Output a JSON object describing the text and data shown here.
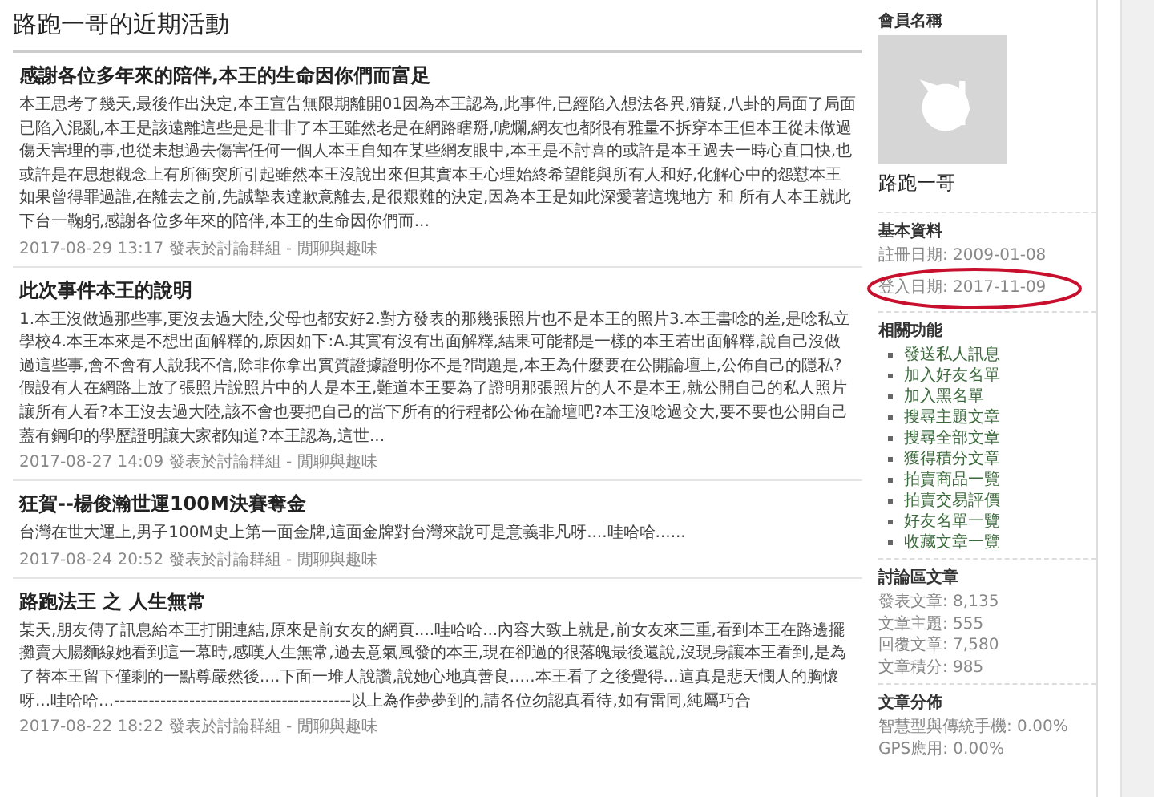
{
  "page_title": "路跑一哥的近期活動",
  "posts": [
    {
      "title": "感謝各位多年來的陪伴,本王的生命因你們而富足",
      "body": "本王思考了幾天,最後作出決定,本王宣告無限期離開01因為本王認為,此事件,已經陷入想法各異,猜疑,八卦的局面了局面已陷入混亂,本王是該遠離這些是是非非了本王雖然老是在網路瞎掰,唬爛,網友也都很有雅量不拆穿本王但本王從未做過傷天害理的事,也從未想過去傷害任何一個人本王自知在某些網友眼中,本王是不討喜的或許是本王過去一時心直口快,也或許是在思想觀念上有所衝突所引起雖然本王沒說出來但其實本王心理始終希望能與所有人和好,化解心中的怨懟本王如果曾得罪過誰,在離去之前,先誠摯表達歉意離去,是很艱難的決定,因為本王是如此深愛著這塊地方 和 所有人本王就此下台一鞠躬,感謝各位多年來的陪伴,本王的生命因你們而...",
      "meta": "2017-08-29 13:17 發表於討論群組 - 閒聊與趣味"
    },
    {
      "title": "此次事件本王的說明",
      "body": "1.本王沒做過那些事,更沒去過大陸,父母也都安好2.對方發表的那幾張照片也不是本王的照片3.本王書唸的差,是唸私立學校4.本王本來是不想出面解釋的,原因如下:A.其實有沒有出面解釋,結果可能都是一樣的本王若出面解釋,說自己沒做過這些事,會不會有人說我不信,除非你拿出實質證據證明你不是?問題是,本王為什麼要在公開論壇上,公佈自己的隱私?假設有人在網路上放了張照片說照片中的人是本王,難道本王要為了證明那張照片的人不是本王,就公開自己的私人照片讓所有人看?本王沒去過大陸,該不會也要把自己的當下所有的行程都公佈在論壇吧?本王沒唸過交大,要不要也公開自己蓋有鋼印的學歷證明讓大家都知道?本王認為,這世...",
      "meta": "2017-08-27 14:09 發表於討論群組 - 閒聊與趣味"
    },
    {
      "title": "狂賀--楊俊瀚世運100M決賽奪金",
      "body": "台灣在世大運上,男子100M史上第一面金牌,這面金牌對台灣來說可是意義非凡呀....哇哈哈......",
      "meta": "2017-08-24 20:52 發表於討論群組 - 閒聊與趣味"
    },
    {
      "title": "路跑法王 之 人生無常",
      "body": "某天,朋友傳了訊息給本王打開連結,原來是前女友的網頁....哇哈哈...內容大致上就是,前女友來三重,看到本王在路邊擺攤賣大腸麵線她看到這一幕時,感嘆人生無常,過去意氣風發的本王,現在卻過的很落魄最後還說,沒現身讓本王看到,是為了替本王留下僅剩的一點尊嚴然後....下面一堆人說讚,說她心地真善良.....本王看了之後覺得...這真是悲天憫人的胸懷呀...哇哈哈...-----------------------------------------以上為作夢夢到的,請各位勿認真看待,如有雷同,純屬巧合",
      "meta": "2017-08-22 18:22 發表於討論群組 - 閒聊與趣味"
    }
  ],
  "sidebar": {
    "member_heading": "會員名稱",
    "member_name": "路跑一哥",
    "basic_heading": "基本資料",
    "basic_info": [
      {
        "text": "註冊日期: 2009-01-08",
        "circled": false
      },
      {
        "text": "登入日期: 2017-11-09",
        "circled": true
      }
    ],
    "functions_heading": "相關功能",
    "functions": [
      "發送私人訊息",
      "加入好友名單",
      "加入黑名單",
      "搜尋主題文章",
      "搜尋全部文章",
      "獲得積分文章",
      "拍賣商品一覽",
      "拍賣交易評價",
      "好友名單一覽",
      "收藏文章一覽"
    ],
    "forum_heading": "討論區文章",
    "forum_stats": [
      "發表文章: 8,135",
      "文章主題: 555",
      "回覆文章: 7,580",
      "文章積分: 985"
    ],
    "distribution_heading": "文章分佈",
    "distribution": [
      "智慧型與傳統手機: 0.00%",
      "GPS應用: 0.00%"
    ]
  }
}
